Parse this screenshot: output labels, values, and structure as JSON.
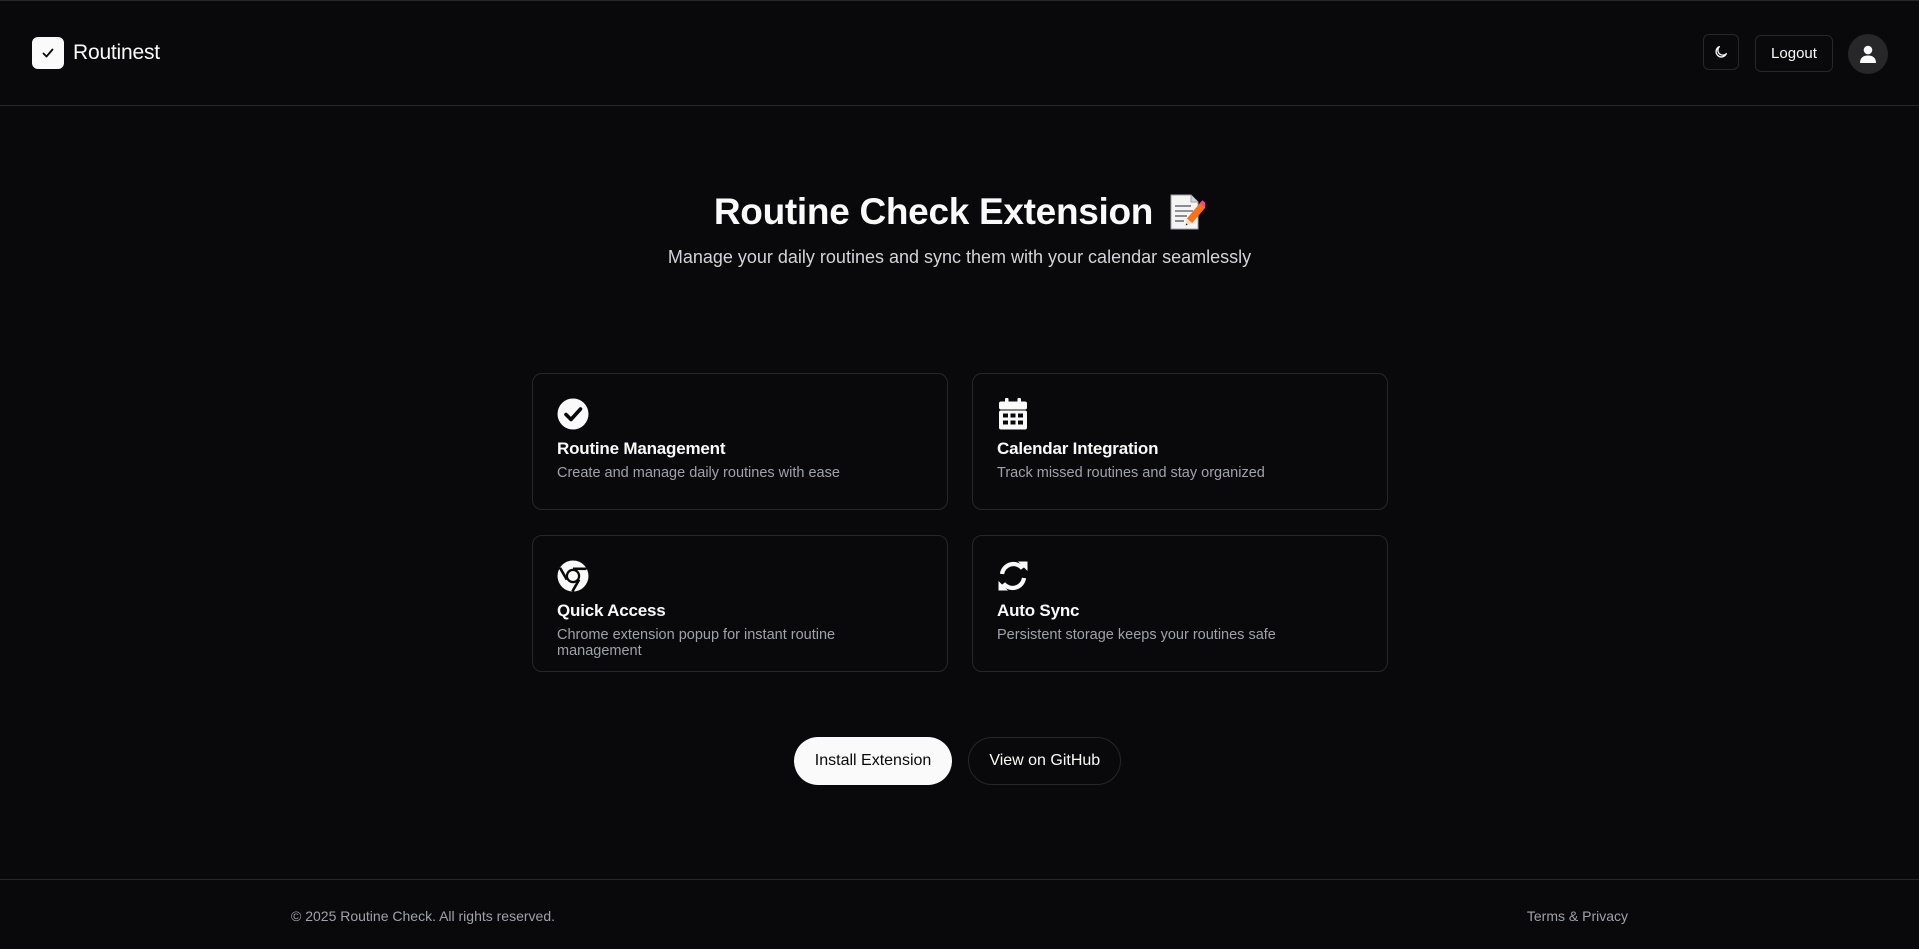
{
  "header": {
    "brand_name": "Routinest",
    "logo_icon": "check-icon",
    "theme_toggle_icon": "moon-icon",
    "logout_label": "Logout",
    "avatar_icon": "user-icon"
  },
  "hero": {
    "title": "Routine Check Extension",
    "title_icon": "memo-emoji-icon",
    "subtitle": "Manage your daily routines and sync them with your calendar seamlessly"
  },
  "features": [
    {
      "icon": "check-circle-icon",
      "title": "Routine Management",
      "description": "Create and manage daily routines with ease"
    },
    {
      "icon": "calendar-icon",
      "title": "Calendar Integration",
      "description": "Track missed routines and stay organized"
    },
    {
      "icon": "chrome-icon",
      "title": "Quick Access",
      "description": "Chrome extension popup for instant routine management"
    },
    {
      "icon": "sync-icon",
      "title": "Auto Sync",
      "description": "Persistent storage keeps your routines safe"
    }
  ],
  "actions": {
    "install_label": "Install Extension",
    "github_label": "View on GitHub"
  },
  "footer": {
    "copyright": "© 2025 Routine Check. All rights reserved.",
    "terms_label": "Terms & Privacy"
  },
  "colors": {
    "background": "#09090b",
    "border": "#27272a",
    "foreground": "#fafafa",
    "muted": "#a1a1aa"
  }
}
